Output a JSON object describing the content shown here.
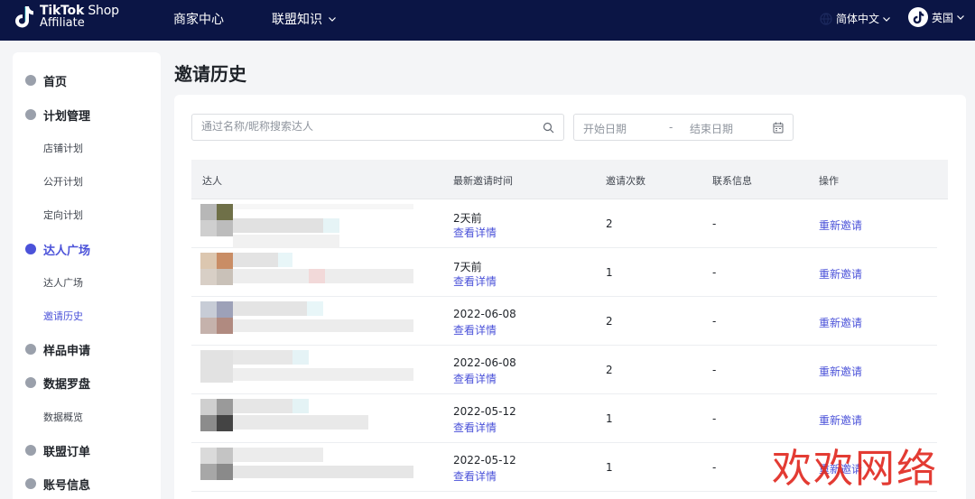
{
  "header": {
    "logo_line1_bold": "TikTok",
    "logo_line1_rest": " Shop",
    "logo_line2": "Affiliate",
    "nav_merchant": "商家中心",
    "nav_knowledge": "联盟知识",
    "language": "简体中文",
    "region": "英国"
  },
  "sidebar": {
    "home": "首页",
    "plan_mgmt": "计划管理",
    "store_plan": "店铺计划",
    "public_plan": "公开计划",
    "targeted_plan": "定向计划",
    "creator_square": "达人广场",
    "creator_square_sub": "达人广场",
    "invite_history": "邀请历史",
    "sample_request": "样品申请",
    "data_compass": "数据罗盘",
    "data_overview": "数据概览",
    "affiliate_orders": "联盟订单",
    "account_info": "账号信息"
  },
  "page": {
    "title": "邀请历史",
    "search_placeholder": "通过名称/昵称搜索达人",
    "start_date": "开始日期",
    "date_sep": "-",
    "end_date": "结束日期"
  },
  "table": {
    "headers": {
      "creator": "达人",
      "latest_time": "最新邀请时间",
      "count": "邀请次数",
      "contact": "联系信息",
      "actions": "操作"
    },
    "rows": [
      {
        "time": "2天前",
        "detail": "查看详情",
        "count": "2",
        "contact": "-",
        "action": "重新邀请"
      },
      {
        "time": "7天前",
        "detail": "查看详情",
        "count": "1",
        "contact": "-",
        "action": "重新邀请"
      },
      {
        "time": "2022-06-08",
        "detail": "查看详情",
        "count": "2",
        "contact": "-",
        "action": "重新邀请"
      },
      {
        "time": "2022-06-08",
        "detail": "查看详情",
        "count": "2",
        "contact": "-",
        "action": "重新邀请"
      },
      {
        "time": "2022-05-12",
        "detail": "查看详情",
        "count": "1",
        "contact": "-",
        "action": "重新邀请"
      },
      {
        "time": "2022-05-12",
        "detail": "查看详情",
        "count": "1",
        "contact": "-",
        "action": "重新邀请"
      }
    ]
  },
  "watermark": "欢欢网络",
  "colors": {
    "header_bg": "#0b1545",
    "accent": "#4b52d9",
    "watermark": "#e0261e"
  }
}
